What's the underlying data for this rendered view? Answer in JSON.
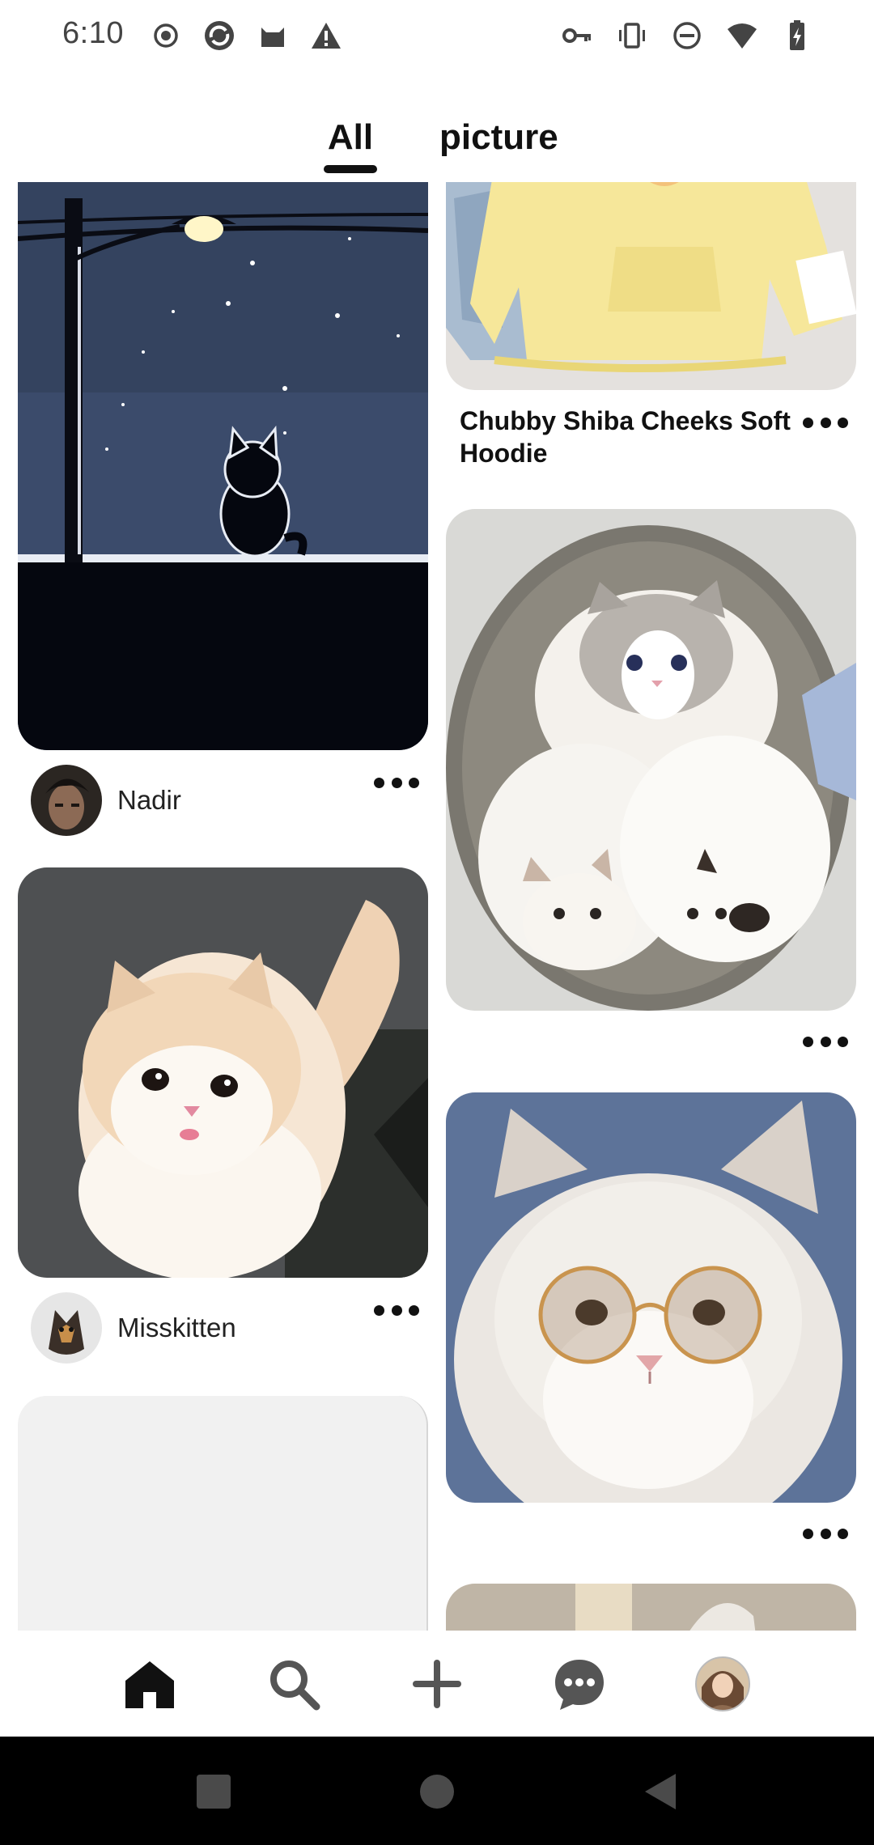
{
  "status_bar": {
    "time": "6:10",
    "left_icons": [
      "record-icon",
      "sync-app-icon",
      "cat-app-icon",
      "warning-icon"
    ],
    "right_icons": [
      "vpn-key-icon",
      "vibrate-icon",
      "do-not-disturb-icon",
      "wifi-icon",
      "battery-charging-icon"
    ]
  },
  "tabs": [
    {
      "label": "All",
      "selected": true
    },
    {
      "label": "picture",
      "selected": false
    }
  ],
  "feed": {
    "left_column": [
      {
        "kind": "image",
        "description_icon": "cat-under-streetlight-image",
        "author": "Nadir"
      },
      {
        "kind": "image",
        "description_icon": "fluffy-cat-image",
        "author": "Misskitten"
      },
      {
        "kind": "placeholder"
      }
    ],
    "right_column": [
      {
        "kind": "image",
        "description_icon": "yellow-hoodie-image",
        "title": "Chubby Shiba Cheeks Soft Hoodie"
      },
      {
        "kind": "image",
        "description_icon": "cats-in-basket-image"
      },
      {
        "kind": "image",
        "description_icon": "cat-with-glasses-image"
      },
      {
        "kind": "image",
        "description_icon": "partial-cat-image"
      }
    ]
  },
  "bottom_nav": [
    "home-icon",
    "search-icon",
    "create-icon",
    "messages-icon",
    "profile-avatar"
  ],
  "colors": {
    "accent": "#111111",
    "night_sky": "#3a4a6b",
    "hoodie_yellow": "#f6e79a"
  }
}
